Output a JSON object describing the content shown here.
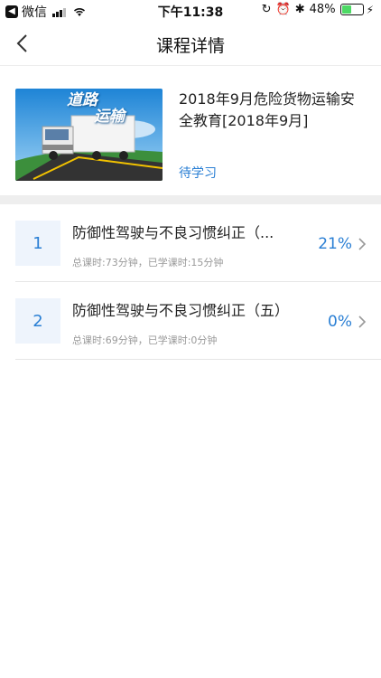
{
  "status_bar": {
    "carrier": "微信",
    "time": "下午11:38",
    "battery": "48%",
    "icons": [
      "back-app-icon",
      "signal-icon",
      "wifi-icon",
      "rotation-lock-icon",
      "alarm-icon",
      "bluetooth-icon",
      "battery-icon",
      "charging-icon"
    ]
  },
  "navbar": {
    "title": "课程详情",
    "back_icon": "chevron-left-icon"
  },
  "course": {
    "thumbnail_caption_line1": "道路",
    "thumbnail_caption_line2": "运输",
    "title": "2018年9月危险货物运输安全教育[2018年9月]",
    "status": "待学习"
  },
  "lessons": [
    {
      "number": "1",
      "name": "防御性驾驶与不良习惯纠正（...",
      "meta": "总课时:73分钟，已学课时:15分钟",
      "percent": "21%"
    },
    {
      "number": "2",
      "name": "防御性驾驶与不良习惯纠正（五）",
      "meta": "总课时:69分钟，已学课时:0分钟",
      "percent": "0%"
    }
  ],
  "colors": {
    "accent": "#2a7fd4",
    "number_bg": "#eef4fc",
    "divider": "#eeeeee"
  }
}
